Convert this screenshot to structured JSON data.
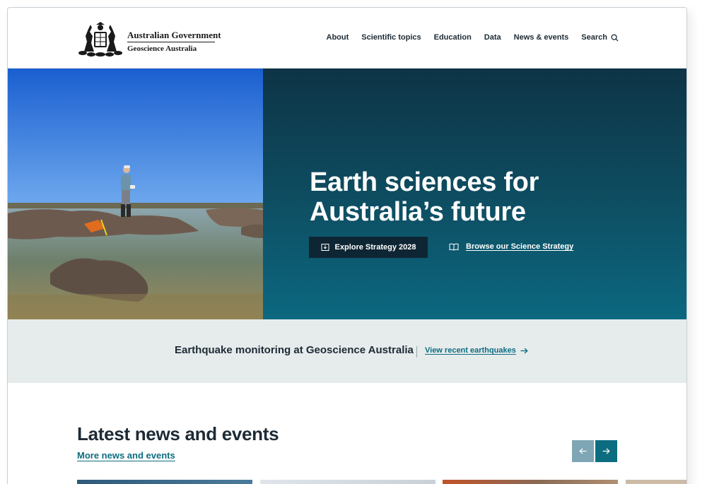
{
  "header": {
    "logo": {
      "line1": "Australian Government",
      "line2": "Geoscience Australia"
    },
    "nav": [
      {
        "label": "About"
      },
      {
        "label": "Scientific topics"
      },
      {
        "label": "Education"
      },
      {
        "label": "Data"
      },
      {
        "label": "News & events"
      },
      {
        "label": "Search",
        "icon": "search-icon"
      }
    ]
  },
  "hero": {
    "title": "Earth sciences for Australia’s future",
    "primary_button": {
      "label": "Explore Strategy 2028",
      "icon": "download-icon"
    },
    "secondary_link": {
      "label": "Browse our Science Strategy",
      "icon": "book-icon"
    }
  },
  "quake": {
    "title": "Earthquake monitoring at Geoscience Australia",
    "link": "View recent earthquakes"
  },
  "news": {
    "title": "Latest news and events",
    "more_link": "More news and events",
    "prev_icon": "arrow-left-icon",
    "next_icon": "arrow-right-icon"
  },
  "colors": {
    "teal": "#0d6d80",
    "dark_navy": "#0e2533",
    "band": "#e6ebec"
  }
}
